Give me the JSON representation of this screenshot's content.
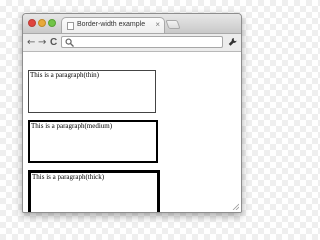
{
  "browser": {
    "tab_title": "Border-width example",
    "tab_close_glyph": "×",
    "omnibox_value": "",
    "nav": {
      "back_glyph": "←",
      "forward_glyph": "→",
      "reload_glyph": "C"
    },
    "icons": {
      "search": "search-icon",
      "wrench": "wrench-icon",
      "favicon": "page-icon"
    }
  },
  "page": {
    "paragraphs": [
      {
        "text": "This is a paragraph(thin)"
      },
      {
        "text": "This is a paragraph(medium)"
      },
      {
        "text": "This is a paragraph(thick)"
      }
    ]
  },
  "colors": {
    "close": "#e0443e",
    "minimize": "#e8a93a",
    "maximize": "#71c447",
    "border": "#000000"
  }
}
